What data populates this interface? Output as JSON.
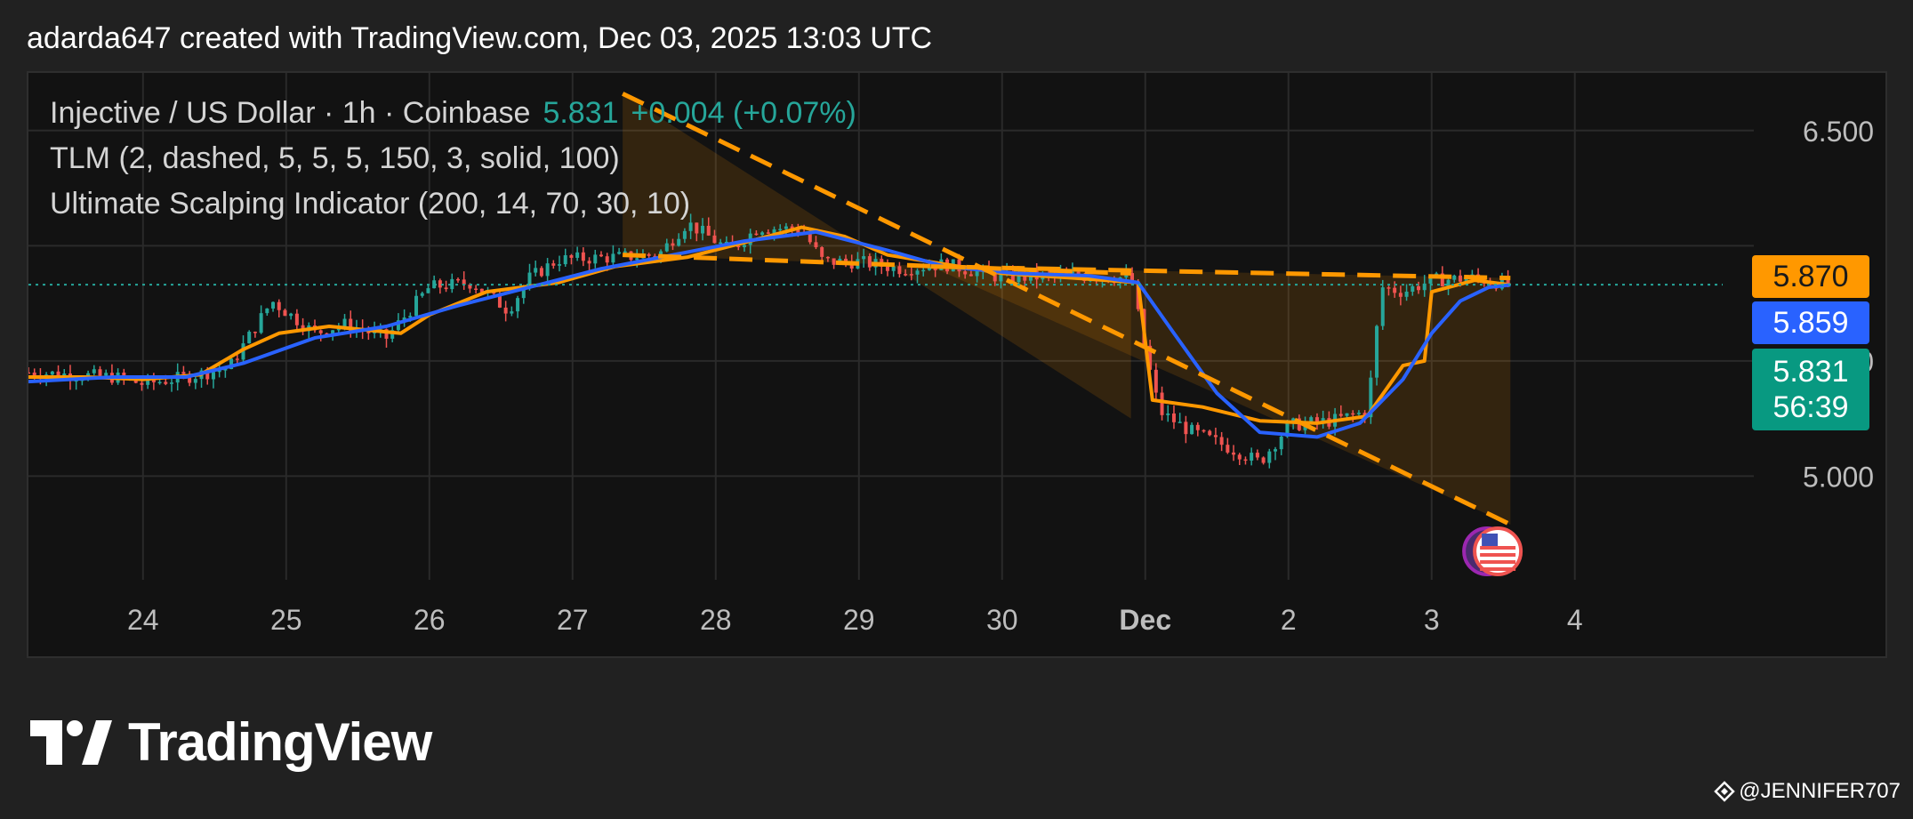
{
  "header": {
    "caption": "adarda647 created with TradingView.com, Dec 03, 2025 13:03 UTC"
  },
  "legend": {
    "symbol": "Injective / US Dollar · 1h · Coinbase",
    "price": "5.831",
    "change": "+0.004 (+0.07%)",
    "indicator_1": "TLM (2, dashed, 5, 5, 5, 150, 3, solid, 100)",
    "indicator_2": "Ultimate Scalping Indicator (200, 14, 70, 30, 10)"
  },
  "price_tags": {
    "orange": "5.870",
    "blue": "5.859",
    "current": "5.831",
    "countdown": "56:39"
  },
  "branding": {
    "wordmark": "TradingView",
    "watermark": "@JENNIFER707"
  },
  "colors": {
    "up": "#26a69a",
    "down": "#ef5350",
    "orange": "#ff9800",
    "blue": "#2962ff",
    "panel": "#121212",
    "grid": "#2a2a2a"
  },
  "chart_data": {
    "type": "candlestick",
    "symbol": "Injective / US Dollar",
    "interval": "1h",
    "exchange": "Coinbase",
    "x_tick_labels": [
      "24",
      "25",
      "26",
      "27",
      "28",
      "29",
      "30",
      "Dec",
      "2",
      "3",
      "4"
    ],
    "x_ticks_day": [
      24,
      25,
      26,
      27,
      28,
      29,
      30,
      31,
      32,
      33,
      34
    ],
    "x_range_day": [
      23.2,
      35.25
    ],
    "y_tick_labels": [
      "6.500",
      "5.500",
      "5.000"
    ],
    "y_ticks": [
      6.5,
      5.5,
      5.0
    ],
    "y_range": [
      4.55,
      6.75
    ],
    "last_price": 5.831,
    "grid": true,
    "price_anchors": [
      [
        23.2,
        5.45
      ],
      [
        23.5,
        5.44
      ],
      [
        23.8,
        5.43
      ],
      [
        24.0,
        5.4
      ],
      [
        24.3,
        5.43
      ],
      [
        24.6,
        5.47
      ],
      [
        24.9,
        5.76
      ],
      [
        25.2,
        5.62
      ],
      [
        25.4,
        5.66
      ],
      [
        25.7,
        5.6
      ],
      [
        26.0,
        5.82
      ],
      [
        26.3,
        5.84
      ],
      [
        26.55,
        5.72
      ],
      [
        26.7,
        5.86
      ],
      [
        26.9,
        5.94
      ],
      [
        27.3,
        5.95
      ],
      [
        27.6,
        5.96
      ],
      [
        27.8,
        6.1
      ],
      [
        28.1,
        5.98
      ],
      [
        28.3,
        6.08
      ],
      [
        28.6,
        6.07
      ],
      [
        28.75,
        5.93
      ],
      [
        29.0,
        5.93
      ],
      [
        29.3,
        5.9
      ],
      [
        29.6,
        5.92
      ],
      [
        30.0,
        5.86
      ],
      [
        30.5,
        5.87
      ],
      [
        30.9,
        5.86
      ],
      [
        31.0,
        5.54
      ],
      [
        31.1,
        5.28
      ],
      [
        31.3,
        5.2
      ],
      [
        31.6,
        5.12
      ],
      [
        31.8,
        5.06
      ],
      [
        32.0,
        5.22
      ],
      [
        32.3,
        5.24
      ],
      [
        32.55,
        5.28
      ],
      [
        32.65,
        5.82
      ],
      [
        32.8,
        5.8
      ],
      [
        33.0,
        5.85
      ],
      [
        33.3,
        5.86
      ],
      [
        33.55,
        5.83
      ]
    ],
    "series": [
      {
        "name": "TLM",
        "points": [
          [
            23.2,
            5.43
          ],
          [
            23.6,
            5.43
          ],
          [
            24.0,
            5.42
          ],
          [
            24.4,
            5.44
          ],
          [
            24.7,
            5.55
          ],
          [
            24.95,
            5.62
          ],
          [
            25.3,
            5.65
          ],
          [
            25.8,
            5.62
          ],
          [
            26.0,
            5.7
          ],
          [
            26.4,
            5.8
          ],
          [
            26.9,
            5.84
          ],
          [
            27.3,
            5.91
          ],
          [
            27.8,
            5.95
          ],
          [
            28.3,
            6.03
          ],
          [
            28.6,
            6.08
          ],
          [
            28.9,
            6.04
          ],
          [
            29.2,
            5.96
          ],
          [
            29.6,
            5.92
          ],
          [
            30.0,
            5.88
          ],
          [
            30.5,
            5.86
          ],
          [
            30.95,
            5.84
          ],
          [
            31.05,
            5.33
          ],
          [
            31.4,
            5.3
          ],
          [
            31.8,
            5.24
          ],
          [
            32.2,
            5.23
          ],
          [
            32.55,
            5.26
          ],
          [
            32.8,
            5.48
          ],
          [
            32.95,
            5.5
          ],
          [
            33.0,
            5.8
          ],
          [
            33.3,
            5.85
          ],
          [
            33.55,
            5.83
          ]
        ]
      },
      {
        "name": "Ultimate Scalping Indicator",
        "points": [
          [
            23.2,
            5.41
          ],
          [
            23.8,
            5.43
          ],
          [
            24.3,
            5.43
          ],
          [
            24.7,
            5.49
          ],
          [
            25.2,
            5.6
          ],
          [
            25.7,
            5.65
          ],
          [
            26.2,
            5.74
          ],
          [
            26.7,
            5.82
          ],
          [
            27.2,
            5.9
          ],
          [
            27.7,
            5.96
          ],
          [
            28.2,
            6.02
          ],
          [
            28.7,
            6.06
          ],
          [
            29.2,
            5.98
          ],
          [
            29.6,
            5.91
          ],
          [
            30.1,
            5.88
          ],
          [
            30.6,
            5.87
          ],
          [
            30.95,
            5.84
          ],
          [
            31.2,
            5.62
          ],
          [
            31.5,
            5.36
          ],
          [
            31.8,
            5.19
          ],
          [
            32.2,
            5.17
          ],
          [
            32.5,
            5.23
          ],
          [
            32.8,
            5.42
          ],
          [
            33.0,
            5.62
          ],
          [
            33.2,
            5.76
          ],
          [
            33.4,
            5.82
          ],
          [
            33.55,
            5.83
          ]
        ]
      }
    ],
    "trendlines": [
      {
        "from": [
          27.35,
          6.66
        ],
        "to": [
          33.55,
          4.79
        ]
      },
      {
        "from": [
          27.35,
          5.96
        ],
        "to": [
          30.9,
          5.88
        ]
      },
      {
        "from": [
          29.5,
          5.91
        ],
        "to": [
          33.55,
          5.86
        ]
      }
    ]
  }
}
